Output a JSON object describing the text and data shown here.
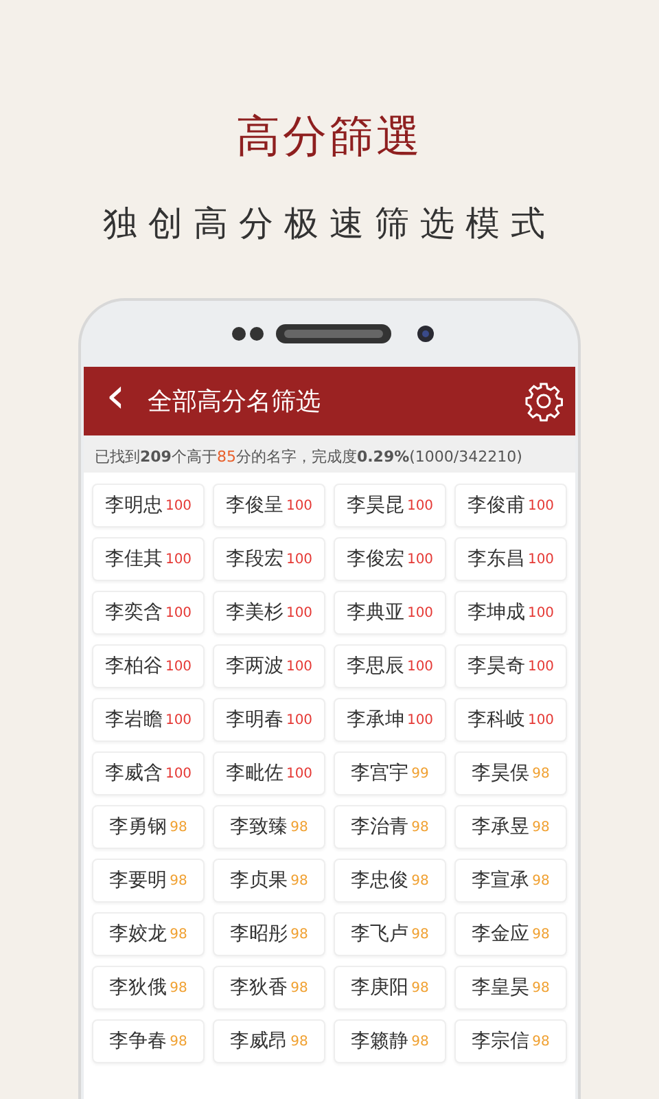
{
  "headline": "高分篩選",
  "tagline": "独创高分极速筛选模式",
  "app_bar": {
    "back": "‹",
    "title": "全部高分名筛选"
  },
  "summary_parts": [
    {
      "text": "已找到",
      "kind": "plain"
    },
    {
      "text": "209",
      "kind": "bold"
    },
    {
      "text": "个高于",
      "kind": "plain"
    },
    {
      "text": "85",
      "kind": "accent"
    },
    {
      "text": "分的名字，完成度",
      "kind": "plain"
    },
    {
      "text": "0.29%",
      "kind": "bold"
    },
    {
      "text": "(1000/342210)",
      "kind": "plain"
    }
  ],
  "names": [
    {
      "name": "李明忠",
      "score": "100",
      "color": "#e53935"
    },
    {
      "name": "李俊呈",
      "score": "100",
      "color": "#e53935"
    },
    {
      "name": "李昊昆",
      "score": "100",
      "color": "#e53935"
    },
    {
      "name": "李俊甫",
      "score": "100",
      "color": "#e53935"
    },
    {
      "name": "李佳其",
      "score": "100",
      "color": "#e53935"
    },
    {
      "name": "李段宏",
      "score": "100",
      "color": "#e53935"
    },
    {
      "name": "李俊宏",
      "score": "100",
      "color": "#e53935"
    },
    {
      "name": "李东昌",
      "score": "100",
      "color": "#e53935"
    },
    {
      "name": "李奕含",
      "score": "100",
      "color": "#e53935"
    },
    {
      "name": "李美杉",
      "score": "100",
      "color": "#e53935"
    },
    {
      "name": "李典亚",
      "score": "100",
      "color": "#e53935"
    },
    {
      "name": "李坤成",
      "score": "100",
      "color": "#e53935"
    },
    {
      "name": "李柏谷",
      "score": "100",
      "color": "#e53935"
    },
    {
      "name": "李两波",
      "score": "100",
      "color": "#e53935"
    },
    {
      "name": "李思辰",
      "score": "100",
      "color": "#e53935"
    },
    {
      "name": "李昊奇",
      "score": "100",
      "color": "#e53935"
    },
    {
      "name": "李岩瞻",
      "score": "100",
      "color": "#e53935"
    },
    {
      "name": "李明春",
      "score": "100",
      "color": "#e53935"
    },
    {
      "name": "李承坤",
      "score": "100",
      "color": "#e53935"
    },
    {
      "name": "李科岐",
      "score": "100",
      "color": "#e53935"
    },
    {
      "name": "李威含",
      "score": "100",
      "color": "#e53935"
    },
    {
      "name": "李毗佐",
      "score": "100",
      "color": "#e53935"
    },
    {
      "name": "李宫宇",
      "score": "99",
      "color": "#f0a030"
    },
    {
      "name": "李昊俣",
      "score": "98",
      "color": "#f0a030"
    },
    {
      "name": "李勇钢",
      "score": "98",
      "color": "#f0a030"
    },
    {
      "name": "李致臻",
      "score": "98",
      "color": "#f0a030"
    },
    {
      "name": "李治青",
      "score": "98",
      "color": "#f0a030"
    },
    {
      "name": "李承昱",
      "score": "98",
      "color": "#f0a030"
    },
    {
      "name": "李要明",
      "score": "98",
      "color": "#f0a030"
    },
    {
      "name": "李贞果",
      "score": "98",
      "color": "#f0a030"
    },
    {
      "name": "李忠俊",
      "score": "98",
      "color": "#f0a030"
    },
    {
      "name": "李宣承",
      "score": "98",
      "color": "#f0a030"
    },
    {
      "name": "李姣龙",
      "score": "98",
      "color": "#f0a030"
    },
    {
      "name": "李昭彤",
      "score": "98",
      "color": "#f0a030"
    },
    {
      "name": "李飞卢",
      "score": "98",
      "color": "#f0a030"
    },
    {
      "name": "李金应",
      "score": "98",
      "color": "#f0a030"
    },
    {
      "name": "李狄俄",
      "score": "98",
      "color": "#f0a030"
    },
    {
      "name": "李狄香",
      "score": "98",
      "color": "#f0a030"
    },
    {
      "name": "李庚阳",
      "score": "98",
      "color": "#f0a030"
    },
    {
      "name": "李皇昊",
      "score": "98",
      "color": "#f0a030"
    },
    {
      "name": "李争春",
      "score": "98",
      "color": "#f0a030"
    },
    {
      "name": "李威昂",
      "score": "98",
      "color": "#f0a030"
    },
    {
      "name": "李籁静",
      "score": "98",
      "color": "#f0a030"
    },
    {
      "name": "李宗信",
      "score": "98",
      "color": "#f0a030"
    }
  ]
}
